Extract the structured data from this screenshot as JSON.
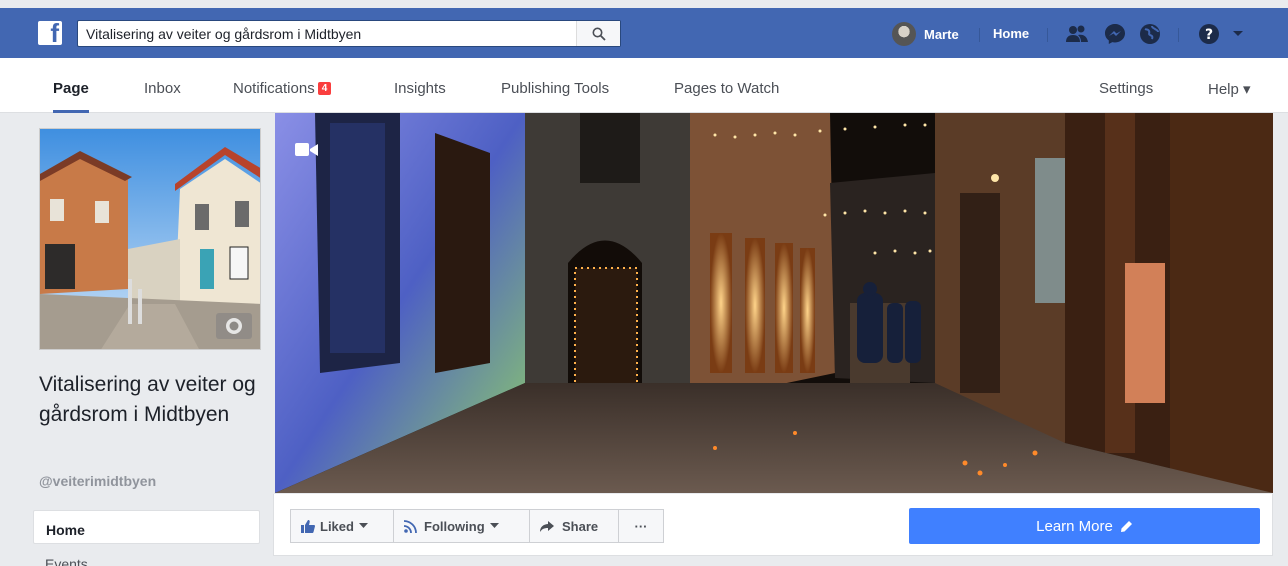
{
  "topbar": {
    "search_value": "Vitalisering av veiter og gårdsrom i Midtbyen",
    "user_name": "Marte",
    "home_label": "Home",
    "logo_letter": "f"
  },
  "tabs": [
    {
      "label": "Page"
    },
    {
      "label": "Inbox"
    },
    {
      "label": "Notifications",
      "badge": "4"
    },
    {
      "label": "Insights"
    },
    {
      "label": "Publishing Tools"
    },
    {
      "label": "Pages to Watch"
    },
    {
      "label": "Settings"
    },
    {
      "label": "Help ▾"
    }
  ],
  "sidebar": {
    "page_name": "Vitalisering av veiter og gårdsrom i Midtbyen",
    "handle": "@veiterimidtbyen",
    "nav": [
      {
        "label": "Home"
      },
      {
        "label": "Events"
      }
    ]
  },
  "actions": {
    "liked": "Liked",
    "following": "Following",
    "share": "Share",
    "more": "···",
    "learn_more": "Learn More"
  },
  "colors": {
    "brand_blue": "#4267b2",
    "cta_blue": "#4080ff",
    "badge_red": "#fa3e3e"
  }
}
